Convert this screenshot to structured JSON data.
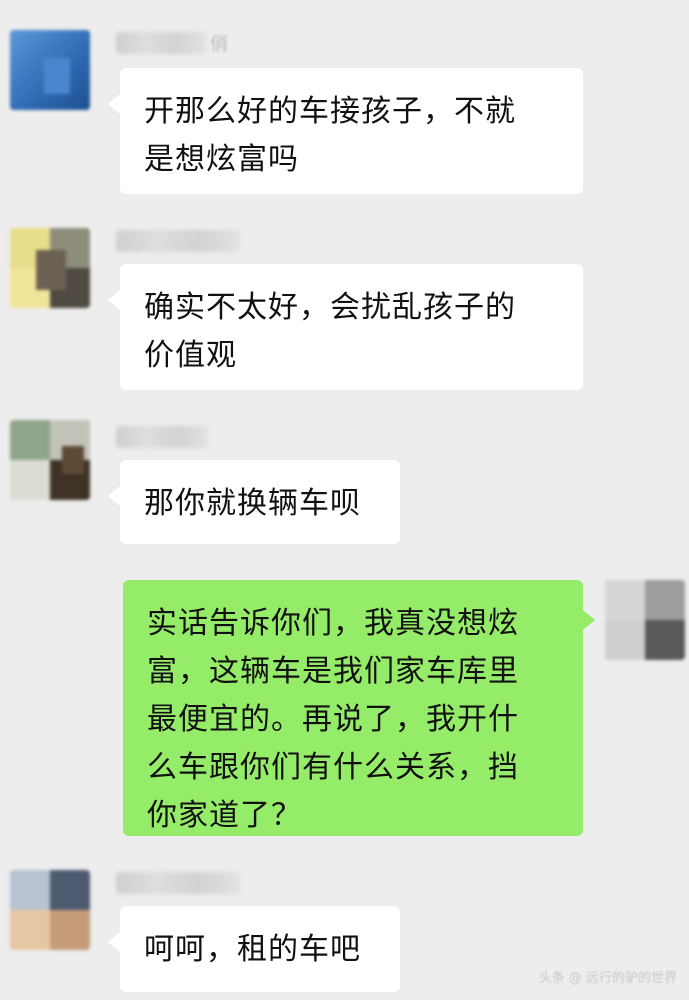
{
  "messages": [
    {
      "side": "left",
      "name_suffix": "俏",
      "text": "开那么好的车接孩子，不就\n是想炫富吗"
    },
    {
      "side": "left",
      "name_suffix": "",
      "text": "确实不太好，会扰乱孩子的\n价值观"
    },
    {
      "side": "left",
      "name_suffix": "",
      "text": "那你就换辆车呗"
    },
    {
      "side": "right",
      "name_suffix": "",
      "text": "实话告诉你们，我真没想炫\n富，这辆车是我们家车库里\n最便宜的。再说了，我开什\n么车跟你们有什么关系，挡\n你家道了？"
    },
    {
      "side": "left",
      "name_suffix": "",
      "text": "呵呵，租的车吧"
    }
  ],
  "watermark": "头条 @ 远行的驴的世界",
  "colors": {
    "background": "#ededed",
    "bubble_left": "#ffffff",
    "bubble_right": "#95ec69"
  }
}
